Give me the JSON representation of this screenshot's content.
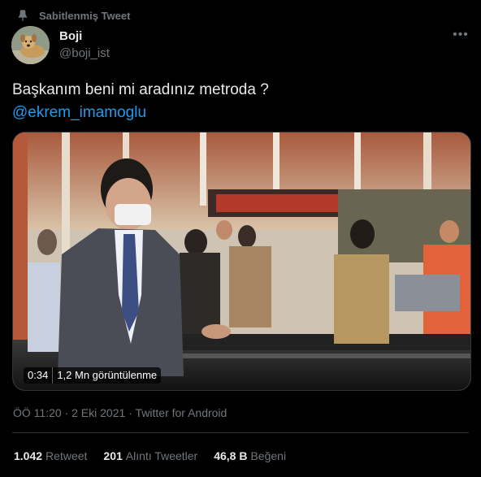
{
  "pinned": {
    "label": "Sabitlenmiş Tweet",
    "icon": "pin-icon"
  },
  "author": {
    "display_name": "Boji",
    "handle": "@boji_ist",
    "avatar": "dog-avatar"
  },
  "more_icon": "more-icon",
  "tweet": {
    "text": "Başkanım beni mi aradınız metroda ?",
    "mention": "@ekrem_imamoglu"
  },
  "media": {
    "duration": "0:34",
    "views": "1,2 Mn görüntülenme"
  },
  "meta": {
    "time": "ÖÖ 11:20",
    "date": "2 Eki 2021",
    "source": "Twitter for Android",
    "separator": " · "
  },
  "stats": {
    "retweets": {
      "count": "1.042",
      "label": "Retweet"
    },
    "quotes": {
      "count": "201",
      "label": "Alıntı Tweetler"
    },
    "likes": {
      "count": "46,8 B",
      "label": "Beğeni"
    }
  },
  "colors": {
    "accent": "#1d9bf0",
    "background": "#000000",
    "text": "#e7e9ea",
    "muted": "#71767b",
    "border": "#2f3336"
  }
}
